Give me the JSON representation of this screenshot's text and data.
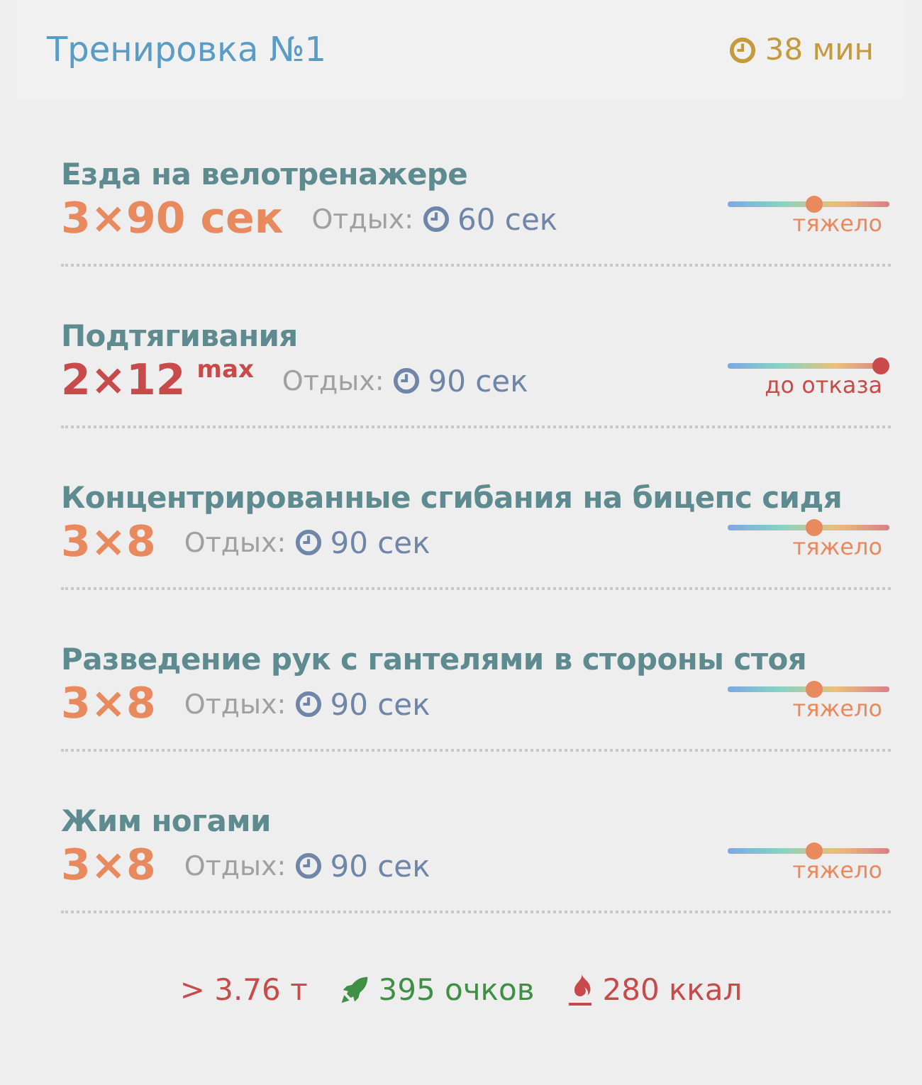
{
  "header": {
    "title": "Тренировка №1",
    "duration": "38 мин"
  },
  "exercises": [
    {
      "name": "Езда на велотренажере",
      "sets": "3×90 сек",
      "rest_label": "Отдых:",
      "rest": "60 сек",
      "intensity": {
        "label": "тяжело",
        "level": 0.54
      },
      "color": "#e8895e"
    },
    {
      "name": "Подтягивания",
      "sets": "2×12",
      "sets_suffix": "max",
      "rest_label": "Отдых:",
      "rest": "90 сек",
      "intensity": {
        "label": "до отказа",
        "level": 1
      },
      "color": "#c84a4a"
    },
    {
      "name": "Концентрированные сгибания на бицепс сидя",
      "sets": "3×8",
      "rest_label": "Отдых:",
      "rest": "90 сек",
      "intensity": {
        "label": "тяжело",
        "level": 0.54
      },
      "color": "#e8895e"
    },
    {
      "name": "Разведение рук с гантелями в стороны стоя",
      "sets": "3×8",
      "rest_label": "Отдых:",
      "rest": "90 сек",
      "intensity": {
        "label": "тяжело",
        "level": 0.54
      },
      "color": "#e8895e"
    },
    {
      "name": "Жим ногами",
      "sets": "3×8",
      "rest_label": "Отдых:",
      "rest": "90 сек",
      "intensity": {
        "label": "тяжело",
        "level": 0.54
      },
      "color": "#e8895e"
    }
  ],
  "summary": [
    {
      "kind": "weight",
      "text": "> 3.76 т"
    },
    {
      "kind": "points",
      "text": "395 очков"
    },
    {
      "kind": "calories",
      "text": "280 ккал"
    }
  ]
}
